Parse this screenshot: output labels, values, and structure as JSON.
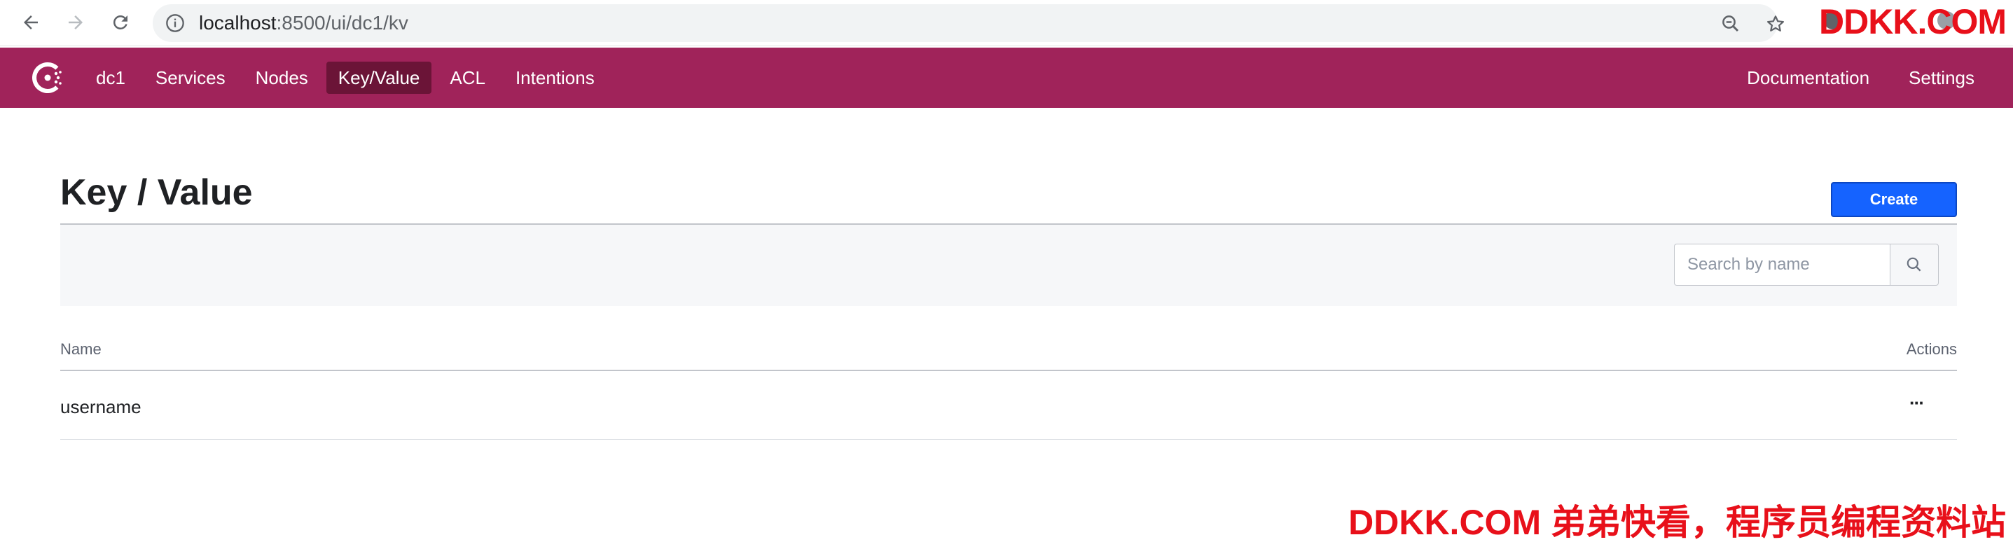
{
  "browser": {
    "url_host": "localhost",
    "url_path": ":8500/ui/dc1/kv",
    "back_icon": "arrow-left-icon",
    "forward_icon": "arrow-right-icon",
    "reload_icon": "reload-icon",
    "info_icon": "info-icon",
    "zoom_icon": "zoom-out-icon",
    "bookmark_icon": "star-icon"
  },
  "watermark": {
    "top": "DDKK.COM",
    "bottom": "DDKK.COM 弟弟快看，程序员编程资料站"
  },
  "header": {
    "brand_color": "#a0235a",
    "active_color": "#6b1437",
    "logo_icon": "consul-logo-icon",
    "nav_items": [
      {
        "label": "dc1",
        "active": false
      },
      {
        "label": "Services",
        "active": false
      },
      {
        "label": "Nodes",
        "active": false
      },
      {
        "label": "Key/Value",
        "active": true
      },
      {
        "label": "ACL",
        "active": false
      },
      {
        "label": "Intentions",
        "active": false
      }
    ],
    "right_items": [
      {
        "label": "Documentation"
      },
      {
        "label": "Settings"
      }
    ]
  },
  "main": {
    "title": "Key / Value",
    "create_label": "Create",
    "create_color": "#1563ff",
    "search": {
      "placeholder": "Search by name",
      "value": "",
      "icon": "search-icon"
    },
    "table": {
      "columns": [
        "Name",
        "Actions"
      ],
      "rows": [
        {
          "name": "username",
          "actions": "···"
        }
      ]
    }
  }
}
